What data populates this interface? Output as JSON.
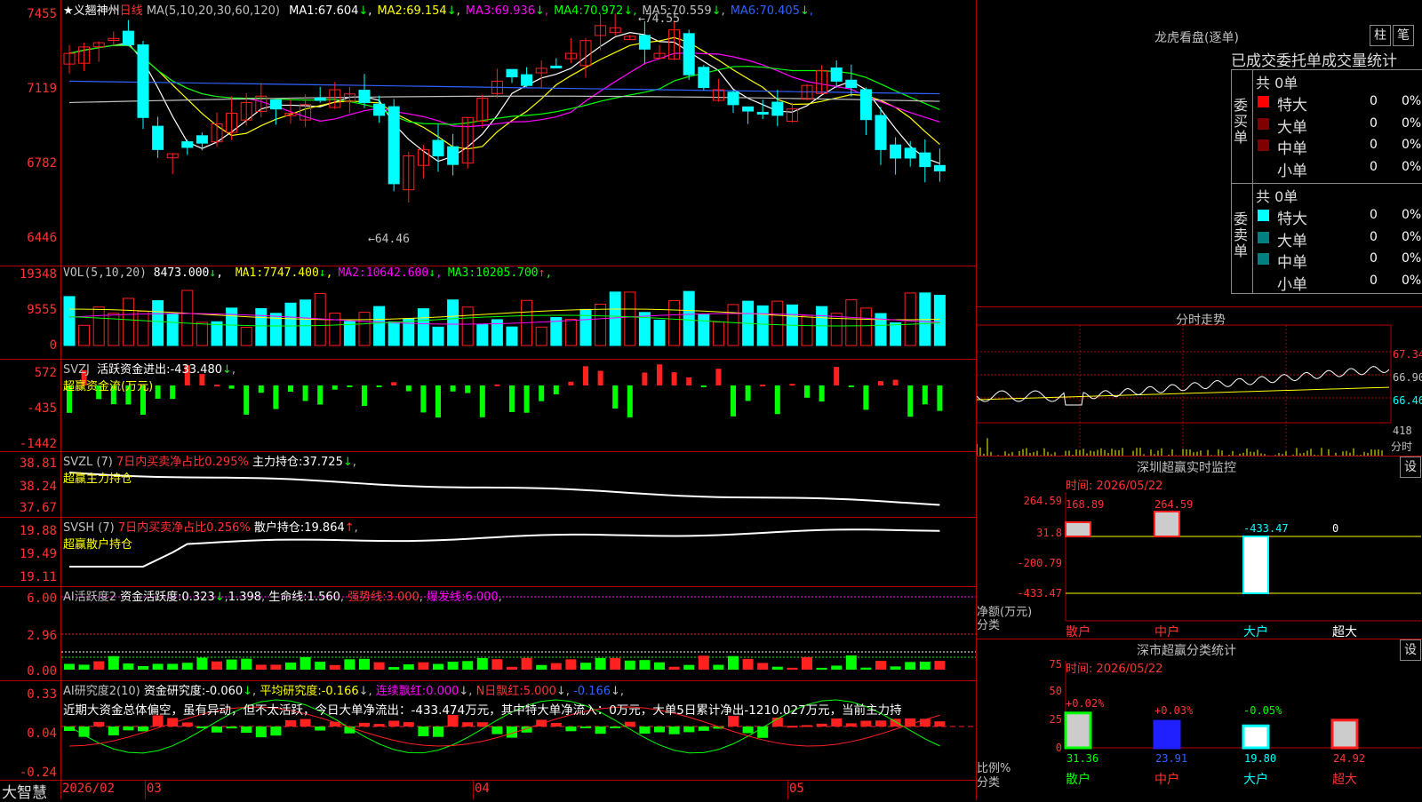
{
  "stock": {
    "name": "★义翘神州",
    "period": "日线",
    "ma_label": "MA(5,10,20,30,60,120)",
    "ma": [
      {
        "label": "MA1:",
        "value": "67.604",
        "arrow": "↓",
        "color": "#ffffff"
      },
      {
        "label": "MA2:",
        "value": "69.154",
        "arrow": "↓",
        "color": "#ffff00"
      },
      {
        "label": "MA3:",
        "value": "69.936",
        "arrow": "↓",
        "color": "#ff00ff"
      },
      {
        "label": "MA4:",
        "value": "70.972",
        "arrow": "↓",
        "color": "#00ff00"
      },
      {
        "label": "MA5:",
        "value": "70.559",
        "arrow": "↓",
        "color": "#c0c0c0"
      },
      {
        "label": "MA6:",
        "value": "70.405",
        "arrow": "↓",
        "color": "#3060ff"
      }
    ],
    "y_ticks": [
      "74.55",
      "71.19",
      "67.82",
      "64.46"
    ],
    "y_ticks_display": [
      "7455",
      "7119",
      "6782",
      "6446"
    ],
    "high_label": "74.55",
    "low_label": "64.46"
  },
  "vol": {
    "label": "VOL(5,10,20)",
    "value": "8473.000",
    "arrow": "↓",
    "ma": [
      {
        "label": "MA1:",
        "value": "7747.400",
        "arrow": "↓",
        "color": "#ffff00"
      },
      {
        "label": "MA2:",
        "value": "10642.600",
        "arrow": "↓",
        "color": "#ff00ff"
      },
      {
        "label": "MA3:",
        "value": "10205.700",
        "arrow": "↑",
        "color": "#00ff00"
      }
    ],
    "y_ticks": [
      "19348",
      "9555",
      "0"
    ]
  },
  "svzj": {
    "label": "SVZJ",
    "item": "活跃资金进出:",
    "value": "-433.480",
    "arrow": "↓",
    "sub": "超赢资金流(万元)",
    "y_ticks": [
      "572",
      "-435",
      "-1442"
    ]
  },
  "svzl": {
    "label": "SVZL (7)",
    "item1": "7日内买卖净占比0.295%",
    "item2": "主力持仓:",
    "value": "37.725",
    "arrow": "↓",
    "sub": "超赢主力持仓",
    "y_ticks": [
      "38.81",
      "38.24",
      "37.67"
    ]
  },
  "svsh": {
    "label": "SVSH (7)",
    "item1": "7日内买卖净占比0.256%",
    "item2": "散户持仓:",
    "value": "19.864",
    "arrow": "↑",
    "sub": "超赢散户持仓",
    "y_ticks": [
      "19.88",
      "19.49",
      "19.11"
    ]
  },
  "ai1": {
    "label": "AI活跃度2",
    "item": "资金活跃度:",
    "value": "0.323",
    "arrow": "↓",
    "v2": "1.398",
    "item3": "生命线:",
    "v3": "1.560",
    "item4": "强势线:",
    "v4": "3.000",
    "item5": "爆发线:",
    "v5": "6.000",
    "y_ticks": [
      "6.00",
      "2.96",
      "0.00"
    ]
  },
  "ai2": {
    "label": "AI研究度2(10)",
    "item": "资金研究度:",
    "value": "-0.060",
    "arrow": "↓",
    "item2": "平均研究度:",
    "v2": "-0.166",
    "item3": "连续飘红:",
    "v3": "0.000",
    "item4": "N日飘红:",
    "v4": "5.000",
    "v5": "-0.166",
    "comment": "近期大资金总体偏空，虽有异动，但不太活跃，今日大单净流出：-433.474万元，其中特大单净流入：0万元，大单5日累计净出-1210.027万元，当前主力持",
    "y_ticks": [
      "0.33",
      "0.04",
      "-0.24"
    ]
  },
  "dates": {
    "brand": "大智慧",
    "items": [
      "2026/02",
      "03",
      "04",
      "05"
    ]
  },
  "dragon": {
    "title": "龙虎看盘(逐单)",
    "btn1": "柱",
    "btn2": "笔",
    "tabs": [
      "已成交",
      "委托单",
      "成交量统计"
    ],
    "buy": {
      "side": "委买单",
      "total": "共 0单",
      "rows": [
        {
          "n": "特大",
          "v": "0",
          "p": "0%",
          "c": "#ff0000"
        },
        {
          "n": "大单",
          "v": "0",
          "p": "0%",
          "c": "#800000"
        },
        {
          "n": "中单",
          "v": "0",
          "p": "0%",
          "c": "#800000"
        },
        {
          "n": "小单",
          "v": "0",
          "p": "0%",
          "c": "#000000"
        }
      ]
    },
    "sell": {
      "side": "委卖单",
      "total": "共 0单",
      "rows": [
        {
          "n": "特大",
          "v": "0",
          "p": "0%",
          "c": "#00ffff"
        },
        {
          "n": "大单",
          "v": "0",
          "p": "0%",
          "c": "#008080"
        },
        {
          "n": "中单",
          "v": "0",
          "p": "0%",
          "c": "#008080"
        },
        {
          "n": "小单",
          "v": "0",
          "p": "0%",
          "c": "#000000"
        }
      ]
    }
  },
  "intraday": {
    "title": "分时走势",
    "y_ticks": [
      "67.34",
      "66.90",
      "66.46"
    ],
    "vol_tick": "418",
    "vol_unit": "分时"
  },
  "monitor": {
    "title": "深圳超赢实时监控",
    "set": "设",
    "time": "时间: 2026/05/22",
    "y_ticks": [
      "264.59",
      "31.8",
      "-200.79",
      "-433.47"
    ],
    "bar_labels": [
      "168.89",
      "264.59",
      "-433.47",
      "0"
    ],
    "cats": [
      "散户",
      "中户",
      "大户",
      "超大"
    ],
    "axis1": "净额(万元)",
    "axis2": "分类"
  },
  "classify": {
    "title": "深市超赢分类统计",
    "set": "设",
    "time": "时间: 2026/05/22",
    "y_ticks": [
      "75",
      "50",
      "25",
      "0"
    ],
    "bar_labels": [
      "+0.02%",
      "+0.03%",
      "-0.05%"
    ],
    "values": [
      "31.36",
      "23.91",
      "19.80",
      "24.92"
    ],
    "cats": [
      "散户",
      "中户",
      "大户",
      "超大"
    ],
    "axis1": "比例%",
    "axis2": "分类"
  },
  "colors": {
    "up": "#ff2020",
    "down": "#00ffff",
    "grid": "#b00000"
  }
}
